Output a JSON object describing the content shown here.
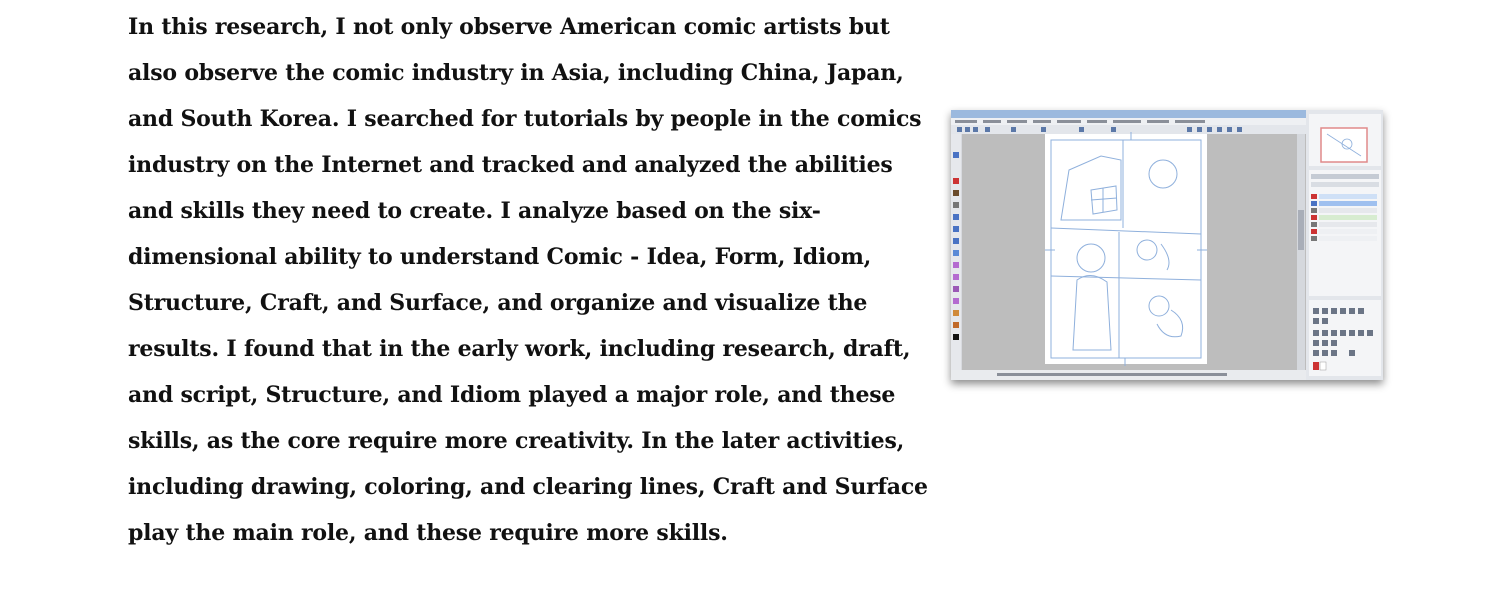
{
  "paragraph": {
    "lines": [
      "In this research, I not only observe American comic artists but",
      "also observe the comic industry in Asia, including China, Japan,",
      "and South Korea. I searched for tutorials by people in the comics",
      "industry on the Internet and tracked and analyzed the abilities",
      "and skills they need to create. I analyze based on the six-",
      "dimensional ability to understand Comic - Idea, Form, Idiom,",
      "Structure, Craft, and Surface, and organize and visualize the",
      "results. I found that in the early work, including research, draft,",
      "and script, Structure, and Idiom played a major role, and these",
      "skills, as the core require more creativity. In the later activities,",
      "including drawing, coloring, and clearing lines, Craft and Surface",
      "play the main role, and these require more skills."
    ]
  },
  "figure": {
    "colors": {
      "window_bg": "#d8dadf",
      "titlebar": "#9bb9de",
      "canvas_gray": "#bdbdbd",
      "paper": "#ffffff",
      "sketch_blue": "#8fb0dc"
    }
  }
}
